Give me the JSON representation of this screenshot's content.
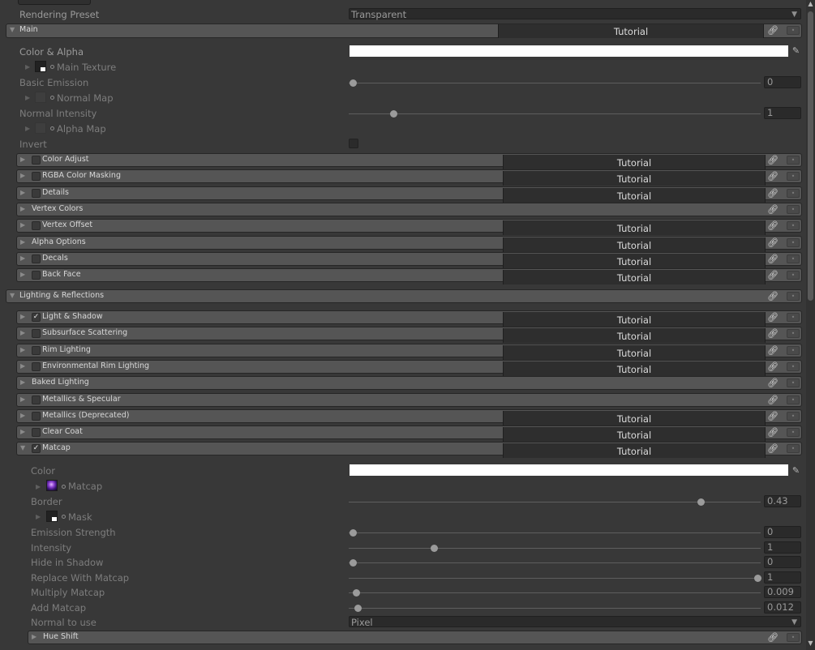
{
  "rendering_preset": {
    "label": "Rendering Preset",
    "value": "Transparent"
  },
  "main": {
    "title": "Main",
    "tutorial": "Tutorial",
    "color_alpha_label": "Color & Alpha",
    "main_texture_label": "Main Texture",
    "basic_emission_label": "Basic Emission",
    "basic_emission_value": "0",
    "basic_emission_level": 0,
    "normal_map_label": "Normal Map",
    "normal_intensity_label": "Normal Intensity",
    "normal_intensity_value": "1",
    "normal_intensity_level": 0.1,
    "alpha_map_label": "Alpha Map",
    "invert_label": "Invert"
  },
  "main_sections": [
    {
      "title": "Color Adjust",
      "checkbox": true,
      "checked": false,
      "tutorial": "Tutorial"
    },
    {
      "title": "RGBA Color Masking",
      "checkbox": true,
      "checked": false,
      "tutorial": "Tutorial"
    },
    {
      "title": "Details",
      "checkbox": true,
      "checked": false,
      "tutorial": "Tutorial"
    },
    {
      "title": "Vertex Colors",
      "checkbox": false,
      "checked": false,
      "tutorial": ""
    },
    {
      "title": "Vertex Offset",
      "checkbox": true,
      "checked": false,
      "tutorial": "Tutorial"
    },
    {
      "title": "Alpha Options",
      "checkbox": false,
      "checked": false,
      "tutorial": "Tutorial"
    },
    {
      "title": "Decals",
      "checkbox": true,
      "checked": false,
      "tutorial": "Tutorial"
    },
    {
      "title": "Back Face",
      "checkbox": true,
      "checked": false,
      "tutorial": "Tutorial"
    }
  ],
  "lighting": {
    "title": "Lighting & Reflections"
  },
  "lighting_sections": [
    {
      "title": "Light & Shadow",
      "checkbox": true,
      "checked": true,
      "tutorial": "Tutorial"
    },
    {
      "title": "Subsurface Scattering",
      "checkbox": true,
      "checked": false,
      "tutorial": "Tutorial"
    },
    {
      "title": "Rim Lighting",
      "checkbox": true,
      "checked": false,
      "tutorial": "Tutorial"
    },
    {
      "title": "Environmental Rim Lighting",
      "checkbox": true,
      "checked": false,
      "tutorial": "Tutorial"
    },
    {
      "title": "Baked Lighting",
      "checkbox": false,
      "checked": false,
      "tutorial": ""
    },
    {
      "title": "Metallics & Specular",
      "checkbox": true,
      "checked": false,
      "tutorial": ""
    },
    {
      "title": "Metallics (Deprecated)",
      "checkbox": true,
      "checked": false,
      "tutorial": "Tutorial"
    },
    {
      "title": "Clear Coat",
      "checkbox": true,
      "checked": false,
      "tutorial": "Tutorial"
    },
    {
      "title": "Matcap",
      "checkbox": true,
      "checked": true,
      "tutorial": "Tutorial",
      "expanded": true
    }
  ],
  "matcap": {
    "color_label": "Color",
    "matcap_texture_label": "Matcap",
    "border_label": "Border",
    "mask_label": "Mask",
    "sliders": [
      {
        "label": "Border",
        "value": "0.43",
        "level": 0.86
      },
      {
        "label": "Emission Strength",
        "value": "0",
        "level": 0.0
      },
      {
        "label": "Intensity",
        "value": "1",
        "level": 0.2
      },
      {
        "label": "Hide in Shadow",
        "value": "0",
        "level": 0.0
      },
      {
        "label": "Replace With Matcap",
        "value": "1",
        "level": 1.0
      },
      {
        "label": "Multiply Matcap",
        "value": "0.009",
        "level": 0.009
      },
      {
        "label": "Add Matcap",
        "value": "0.012",
        "level": 0.012
      }
    ],
    "normal_label": "Normal to use",
    "normal_value": "Pixel"
  },
  "hue_shift": {
    "title": "Hue Shift"
  },
  "icons": {
    "link": "link-icon",
    "reset": "reset-icon",
    "picker": "eyedropper-icon",
    "fold": "foldout-arrow-icon",
    "check": "checkmark-icon"
  },
  "colors": {
    "background": "#383838",
    "header": "#555555",
    "tutorial_bg": "#2e2e2e"
  }
}
